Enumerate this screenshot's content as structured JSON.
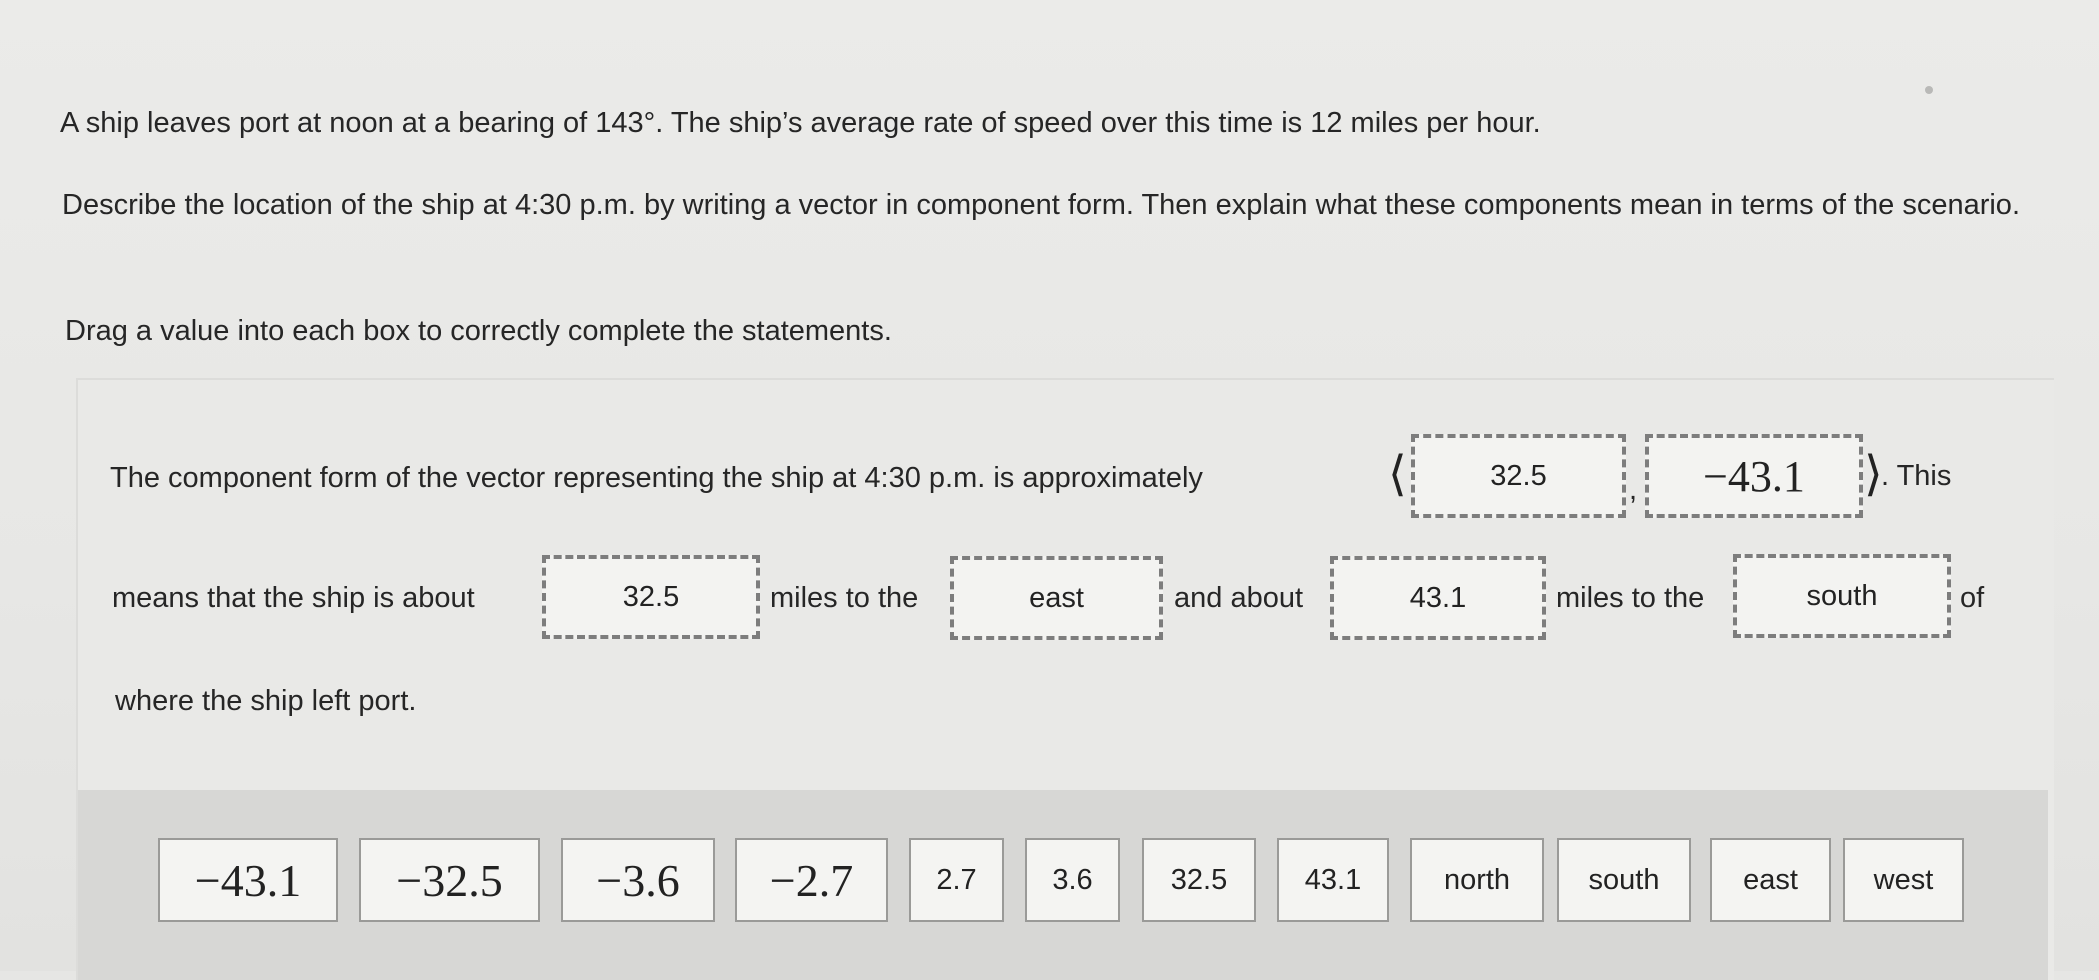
{
  "question": {
    "line1": "A ship leaves port at noon at a bearing of 143°.  The ship’s average rate of speed over this time is 12 miles per hour.",
    "line2": "Describe the location of the ship at 4:30 p.m. by writing a vector in component form. Then explain what these components mean in terms of the scenario.",
    "instruction": "Drag a value into each box to correctly complete the statements."
  },
  "statement": {
    "part1": "The component form of the vector representing the ship at 4:30 p.m. is approximately",
    "left_angle": "⟨",
    "comma": ",",
    "right_angle": "⟩",
    "part2": ". This",
    "part3": "means that the ship is about",
    "part4": "miles to the",
    "part5": "and about",
    "part6": "miles to the",
    "part7": "of",
    "part8": "where the ship left port."
  },
  "answers": {
    "x_component": "32.5",
    "y_component": "−43.1",
    "distance_1": "32.5",
    "direction_1": "east",
    "distance_2": "43.1",
    "direction_2": "south"
  },
  "tiles": [
    "−43.1",
    "−32.5",
    "−3.6",
    "−2.7",
    "2.7",
    "3.6",
    "32.5",
    "43.1",
    "north",
    "south",
    "east",
    "west"
  ]
}
